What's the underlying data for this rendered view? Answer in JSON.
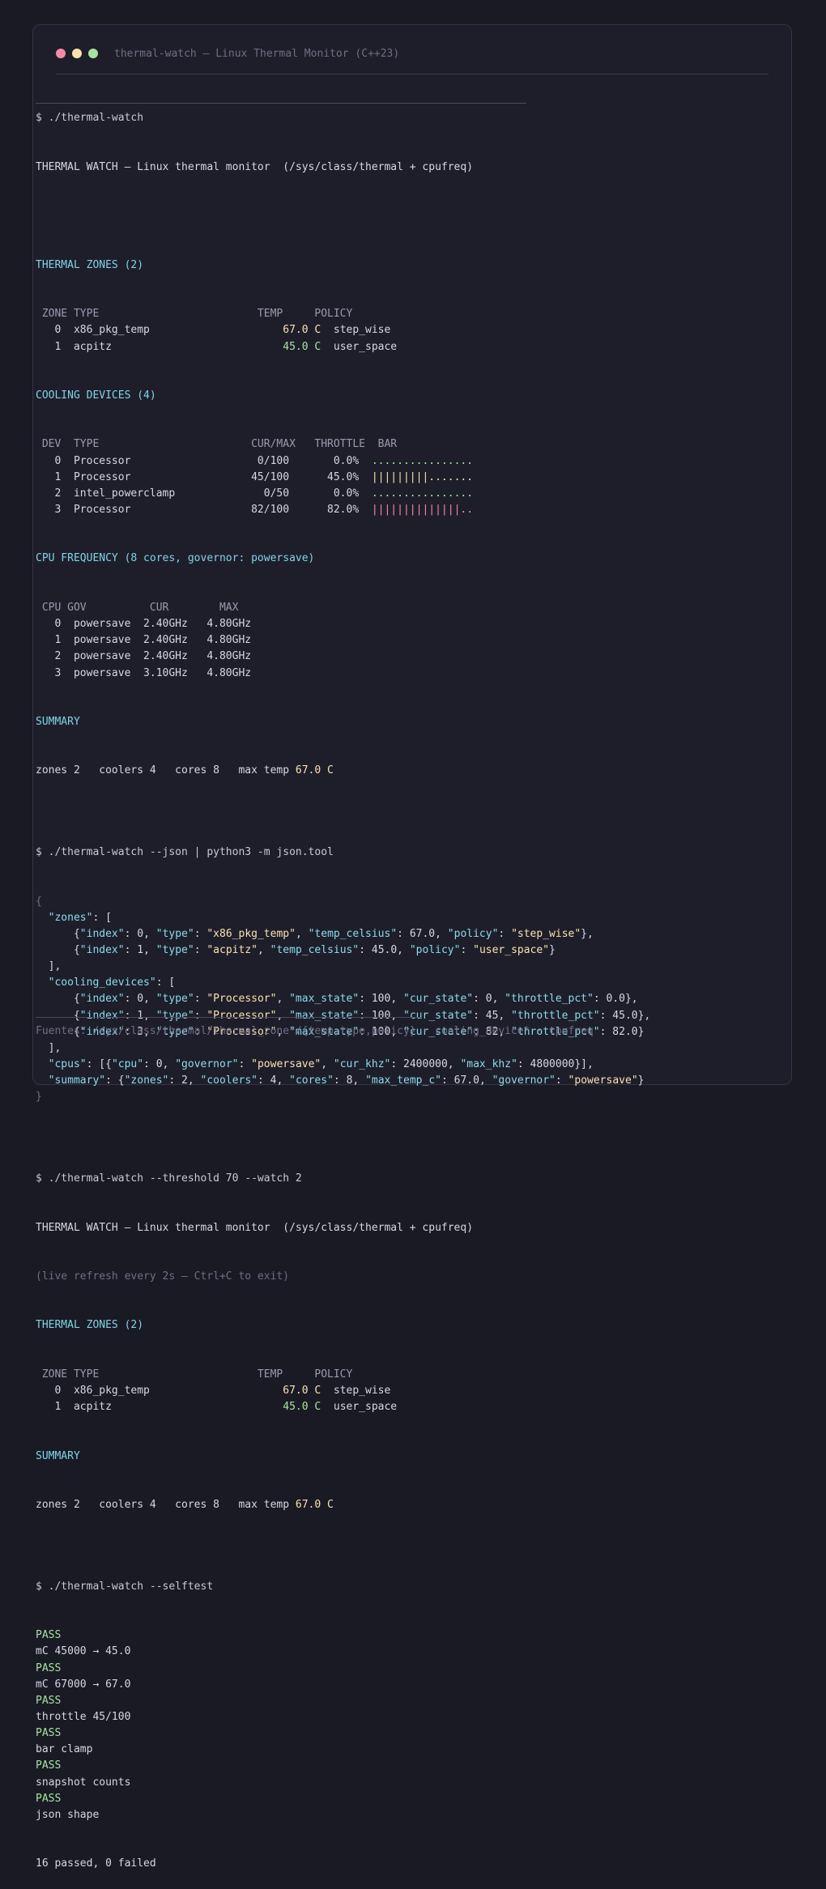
{
  "window": {
    "title": "thermal-watch — Linux Thermal Monitor (C++23)",
    "dots": [
      "#f38ba8",
      "#f9e2af",
      "#a6e3a1"
    ]
  },
  "colors": {
    "accent_cyan": "#7fd4e6",
    "pass_green": "#a6e3a1",
    "warm_yellow": "#f9e2af",
    "bar_red": "#f38ba8"
  },
  "run1": {
    "prompt": "$ ./thermal-watch",
    "banner": "THERMAL WATCH — Linux thermal monitor  (/sys/class/thermal + cpufreq)",
    "zones_header": "THERMAL ZONES (2)",
    "zones_cols": [
      " ZONE",
      "TYPE",
      "TEMP",
      "POLICY"
    ],
    "zones": [
      {
        "idx": "0",
        "type": "x86_pkg_temp",
        "temp": "67.0 C",
        "policy": "step_wise",
        "level": "warm"
      },
      {
        "idx": "1",
        "type": "acpitz",
        "temp": "45.0 C",
        "policy": "user_space",
        "level": "cool"
      }
    ],
    "cooling_header": "COOLING DEVICES (4)",
    "cooling_cols": [
      " DEV",
      "TYPE",
      "CUR/MAX",
      "THROTTLE",
      "BAR"
    ],
    "cooling": [
      {
        "idx": "0",
        "type": "Processor",
        "curmax": "0/100",
        "throttle": "0.0%",
        "bar_fill": 0,
        "bar_color": "g"
      },
      {
        "idx": "1",
        "type": "Processor",
        "curmax": "45/100",
        "throttle": "45.0%",
        "bar_fill": 9,
        "bar_color": "y"
      },
      {
        "idx": "2",
        "type": "intel_powerclamp",
        "curmax": "0/50",
        "throttle": "0.0%",
        "bar_fill": 0,
        "bar_color": "g"
      },
      {
        "idx": "3",
        "type": "Processor",
        "curmax": "82/100",
        "throttle": "82.0%",
        "bar_fill": 14,
        "bar_color": "r"
      }
    ],
    "bar_width": 16,
    "cpu_header": "CPU FREQUENCY (8 cores, governor: powersave)",
    "cpu_cols": [
      " CPU",
      "GOV",
      "CUR",
      "MAX"
    ],
    "cpus": [
      {
        "idx": "0",
        "gov": "powersave",
        "cur": "2.40GHz",
        "max": "4.80GHz"
      },
      {
        "idx": "1",
        "gov": "powersave",
        "cur": "2.40GHz",
        "max": "4.80GHz"
      },
      {
        "idx": "2",
        "gov": "powersave",
        "cur": "2.40GHz",
        "max": "4.80GHz"
      },
      {
        "idx": "3",
        "gov": "powersave",
        "cur": "3.10GHz",
        "max": "4.80GHz"
      }
    ],
    "summary_header": "SUMMARY",
    "summary_text": "zones 2   coolers 4   cores 8   max temp ",
    "summary_temp": "67.0 C"
  },
  "run2": {
    "prompt": "$ ./thermal-watch --json | python3 -m json.tool"
  },
  "run3": {
    "prompt": "$ ./thermal-watch --threshold 70 --watch 2",
    "banner": "THERMAL WATCH — Linux thermal monitor  (/sys/class/thermal + cpufreq)",
    "refresh_note": "(live refresh every 2s — Ctrl+C to exit)",
    "zones_header": "THERMAL ZONES (2)",
    "summary_header": "SUMMARY",
    "summary_text": "zones 2   coolers 4   cores 8   max temp ",
    "summary_temp": "67.0 C"
  },
  "run4": {
    "prompt": "$ ./thermal-watch --selftest",
    "tests": [
      {
        "status": "PASS",
        "name": "mC 45000 → 45.0"
      },
      {
        "status": "PASS",
        "name": "mC 67000 → 67.0"
      },
      {
        "status": "PASS",
        "name": "throttle 45/100"
      },
      {
        "status": "PASS",
        "name": "bar clamp"
      },
      {
        "status": "PASS",
        "name": "snapshot counts"
      },
      {
        "status": "PASS",
        "name": "json shape"
      }
    ],
    "result": "16 passed, 0 failed"
  },
  "footer": "Fuentes: /sys/class/thermal/thermal_zone*/{temp,type,policy} · cooling_device* · cpufreq"
}
